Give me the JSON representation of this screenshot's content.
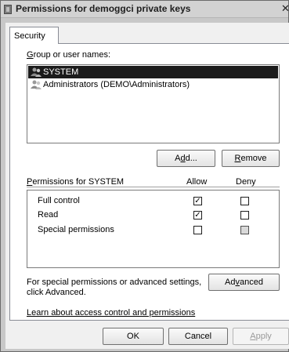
{
  "window": {
    "title": "Permissions for demoggci private keys",
    "close_glyph": "✕"
  },
  "tabs": [
    {
      "label": "Security"
    }
  ],
  "group_section": {
    "label_accel": "G",
    "label_rest": "roup or user names:",
    "users": [
      {
        "name": "SYSTEM",
        "icon": "user-group-icon",
        "selected": true
      },
      {
        "name": "Administrators (DEMO\\Administrators)",
        "icon": "user-group-icon",
        "selected": false
      }
    ]
  },
  "buttons": {
    "add_pre": "A",
    "add_accel": "d",
    "add_post": "d...",
    "remove_accel": "R",
    "remove_rest": "emove",
    "advanced_pre": "Ad",
    "advanced_accel": "v",
    "advanced_post": "anced",
    "ok": "OK",
    "cancel": "Cancel",
    "apply_accel": "A",
    "apply_rest": "pply"
  },
  "permissions": {
    "label_accel": "P",
    "label_rest": "ermissions for SYSTEM",
    "allow_header": "Allow",
    "deny_header": "Deny",
    "rows": [
      {
        "name": "Full control",
        "allow": true,
        "deny": false,
        "shaded": false
      },
      {
        "name": "Read",
        "allow": true,
        "deny": false,
        "shaded": false
      },
      {
        "name": "Special permissions",
        "allow": false,
        "deny": false,
        "shaded": true
      }
    ],
    "check_glyph": "✓"
  },
  "advanced_note": {
    "line1": "For special permissions or advanced settings,",
    "line2": "click Advanced."
  },
  "learn_link": "Learn about access control and permissions"
}
